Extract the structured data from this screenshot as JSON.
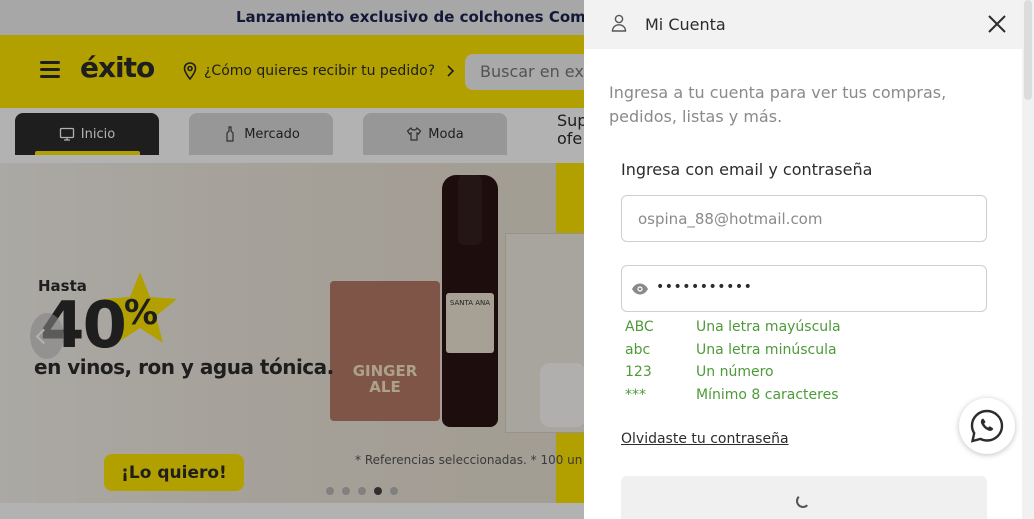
{
  "promo": {
    "text": "Lanzamiento exclusivo de colchones Come"
  },
  "header": {
    "logo": "éxito",
    "delivery_prompt": "¿Cómo quieres recibir tu pedido?",
    "search_placeholder": "Buscar en ex"
  },
  "tabs": [
    {
      "label": "Inicio",
      "icon": "monitor-icon",
      "active": true
    },
    {
      "label": "Mercado",
      "icon": "bottle-icon",
      "active": false
    },
    {
      "label": "Moda",
      "icon": "shirt-icon",
      "active": false
    }
  ],
  "tab_overflow": {
    "line1": "Sup",
    "line2": "ofe"
  },
  "banner": {
    "hasta": "Hasta",
    "percent": "40",
    "percent_sign": "%",
    "headline": "en vinos, ron y agua tónica.",
    "cta": "¡Lo quiero!",
    "disclaimer": "* Referencias seleccionadas. * 100 un",
    "pack_label": "GINGER ALE",
    "wine_label": "SANTA ANA",
    "slides_total": 5,
    "slide_active": 4
  },
  "panel": {
    "title": "Mi Cuenta",
    "intro": "Ingresa a tu cuenta para ver tus compras, pedidos, listas y más.",
    "subheading": "Ingresa con email y contraseña",
    "email_value": "ospina_88@hotmail.com",
    "password_masked": "•••••••••••",
    "rules": [
      {
        "code": "ABC",
        "text": "Una letra mayúscula"
      },
      {
        "code": "abc",
        "text": "Una letra minúscula"
      },
      {
        "code": "123",
        "text": "Un número"
      },
      {
        "code": "***",
        "text": "Mínimo 8 caracteres"
      }
    ],
    "forgot": "Olvidaste tu contraseña"
  },
  "colors": {
    "brand_yellow": "#ffe600",
    "dark": "#2c2c2c",
    "rule_green": "#4e9a3a"
  }
}
